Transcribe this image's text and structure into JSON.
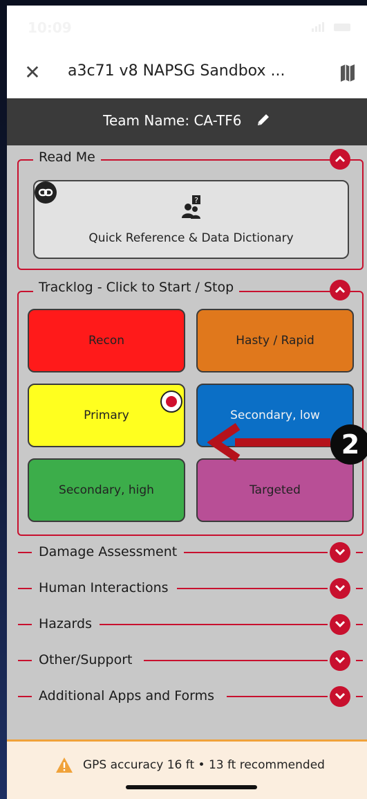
{
  "status_bar": {
    "time": "10:09"
  },
  "title_bar": {
    "close_icon": "close-icon",
    "title": "a3c71 v8 NAPSG Sandbox ...",
    "map_icon": "map-icon"
  },
  "team_bar": {
    "label": "Team Name: CA-TF6",
    "edit_icon": "pencil-icon"
  },
  "read_me": {
    "title": "Read Me",
    "card": {
      "label": "Quick Reference & Data Dictionary",
      "link_icon": "link-icon",
      "icon": "people-question-icon"
    }
  },
  "tracklog": {
    "title": "Tracklog - Click to Start / Stop",
    "buttons": [
      {
        "label": "Recon",
        "color": "#ff1a1a"
      },
      {
        "label": "Hasty / Rapid",
        "color": "#e0781c"
      },
      {
        "label": "Primary",
        "color": "#ffff1f",
        "recording": true
      },
      {
        "label": "Secondary, low",
        "color": "#0b6fc6"
      },
      {
        "label": "Secondary, high",
        "color": "#3cad4a"
      },
      {
        "label": "Targeted",
        "color": "#b84f96"
      }
    ]
  },
  "collapsed_sections": [
    {
      "title": "Damage Assessment"
    },
    {
      "title": "Human Interactions"
    },
    {
      "title": "Hazards"
    },
    {
      "title": "Other/Support"
    },
    {
      "title": "Additional Apps and Forms"
    }
  ],
  "gps": {
    "text": "GPS accuracy 16 ft • 13 ft recommended",
    "icon": "warning-icon"
  },
  "annotation": {
    "badge": "2"
  },
  "colors": {
    "accent": "#c8102e",
    "background": "#c8c8c8",
    "team_bar": "#3a3a3a",
    "gps_bar": "#fbeedf"
  }
}
